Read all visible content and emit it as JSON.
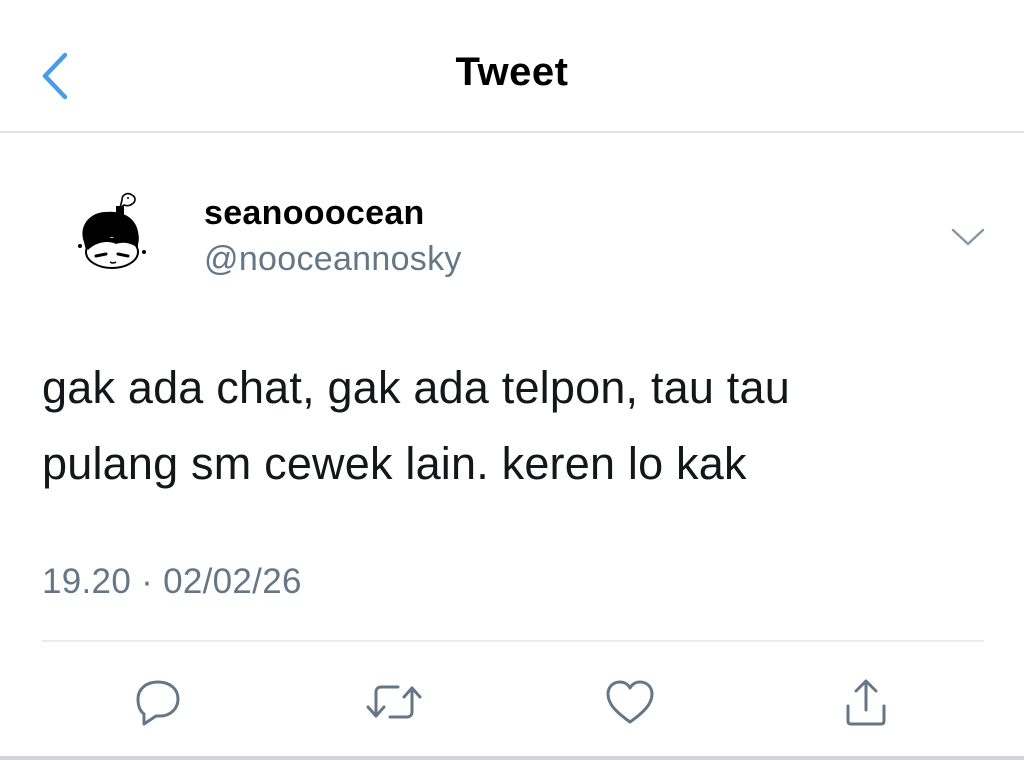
{
  "header": {
    "title": "Tweet",
    "back_icon": "chevron-left-icon",
    "accent_color": "#1da1f2"
  },
  "tweet": {
    "author": {
      "display_name": "seanooocean",
      "handle": "@nooceannosky",
      "avatar_icon": "avatar-illustration"
    },
    "more_icon": "chevron-down-icon",
    "text_lines": [
      "gak ada chat, gak ada telpon, tau tau",
      "pulang sm cewek lain. keren lo kak"
    ],
    "timestamp": "19.20 · 02/02/26"
  },
  "actions": [
    {
      "name": "reply",
      "icon": "reply-icon"
    },
    {
      "name": "retweet",
      "icon": "retweet-icon"
    },
    {
      "name": "like",
      "icon": "heart-icon"
    },
    {
      "name": "share",
      "icon": "share-icon"
    }
  ],
  "colors": {
    "text": "#14171a",
    "secondary": "#657786",
    "icon": "#657786",
    "divider": "#e6ecf0"
  }
}
